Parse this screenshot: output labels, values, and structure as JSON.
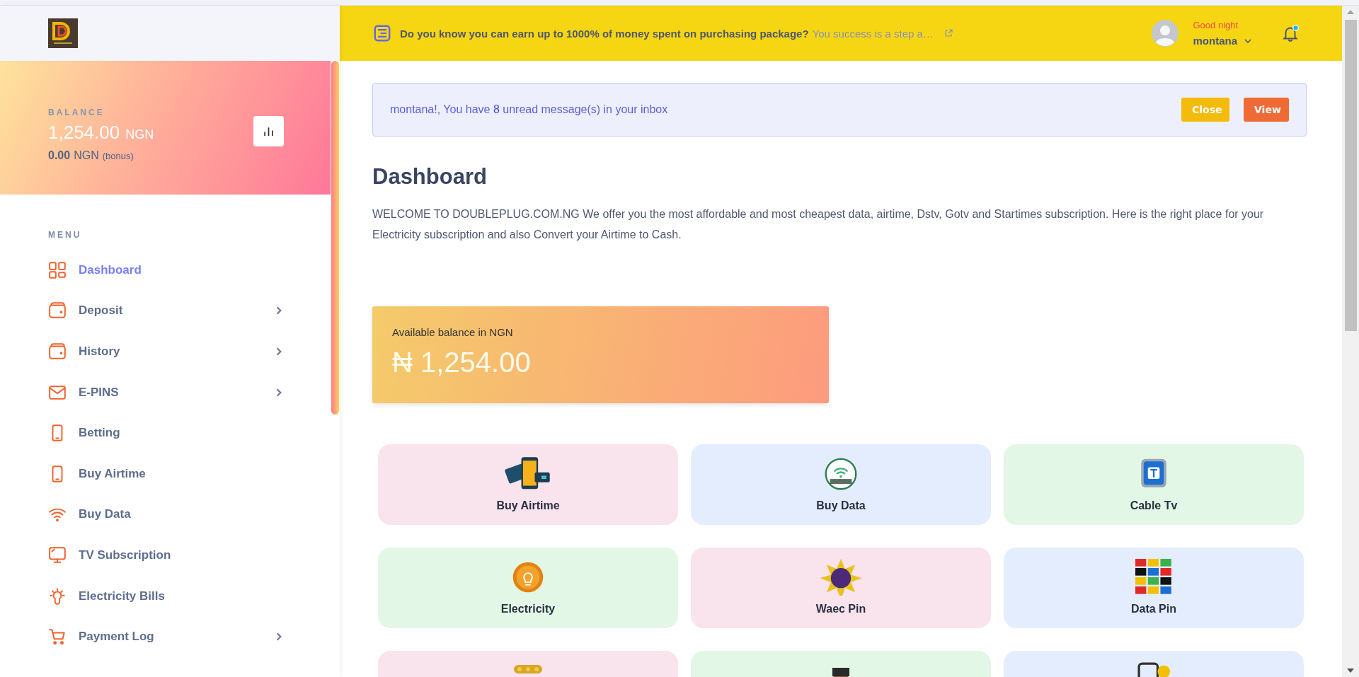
{
  "sidebar": {
    "balance": {
      "label": "BALANCE",
      "amount": "1,254.00",
      "currency": "NGN",
      "bonus_amount": "0.00",
      "bonus_currency": "NGN",
      "bonus_note": "(bonus)"
    },
    "menu_title": "MENU",
    "items": [
      {
        "label": "Dashboard",
        "kind": "grid",
        "has_submenu": false,
        "selected": true
      },
      {
        "label": "Deposit",
        "kind": "wallet",
        "has_submenu": true,
        "selected": false
      },
      {
        "label": "History",
        "kind": "wallet",
        "has_submenu": true,
        "selected": false
      },
      {
        "label": "E-PINS",
        "kind": "mail",
        "has_submenu": true,
        "selected": false
      },
      {
        "label": "Betting",
        "kind": "phone",
        "has_submenu": false,
        "selected": false
      },
      {
        "label": "Buy Airtime",
        "kind": "phone",
        "has_submenu": false,
        "selected": false
      },
      {
        "label": "Buy Data",
        "kind": "wifi",
        "has_submenu": false,
        "selected": false
      },
      {
        "label": "TV Subscription",
        "kind": "monitor",
        "has_submenu": false,
        "selected": false
      },
      {
        "label": "Electricity Bills",
        "kind": "bulb",
        "has_submenu": false,
        "selected": false
      },
      {
        "label": "Payment Log",
        "kind": "cart",
        "has_submenu": true,
        "selected": false
      }
    ]
  },
  "topbar": {
    "notice": "Do you know you can earn up to 1000% of money spent on purchasing package?",
    "notice_more": "You success is a step a…",
    "greeting": "Good night",
    "user": "montana",
    "notifications_unread": true
  },
  "alert": {
    "before": "montana!, You have",
    "count": "8",
    "after": "unread message(s) in your inbox",
    "buttons": [
      "Close",
      "View"
    ]
  },
  "page_title": "Dashboard",
  "intro": "WELCOME TO DOUBLEPLUG.COM.NG We offer you the most affordable and most cheapest data, airtime, Dstv, Gotv and Startimes subscription. Here is the right place for your Electricity subscription and also Convert your Airtime to Cash.",
  "balance_card": {
    "label": "Available balance in NGN",
    "amount": "₦ 1,254.00"
  },
  "services": [
    {
      "label": "Buy Airtime",
      "kind": "airtime",
      "color": "#f9e3ec"
    },
    {
      "label": "Buy Data",
      "kind": "data",
      "color": "#e3edfd"
    },
    {
      "label": "Cable Tv",
      "kind": "tv",
      "color": "#e2f7e5"
    },
    {
      "label": "Electricity",
      "kind": "electricity",
      "color": "#e2f7e5"
    },
    {
      "label": "Waec Pin",
      "kind": "waec",
      "color": "#f9e3ec"
    },
    {
      "label": "Data Pin",
      "kind": "datapin",
      "color": "#e3edfd"
    },
    {
      "kind": "coins",
      "color": "#f9e3ec"
    },
    {
      "kind": "person",
      "color": "#e2f7e5"
    },
    {
      "kind": "mobile",
      "color": "#e3edfd"
    }
  ]
}
